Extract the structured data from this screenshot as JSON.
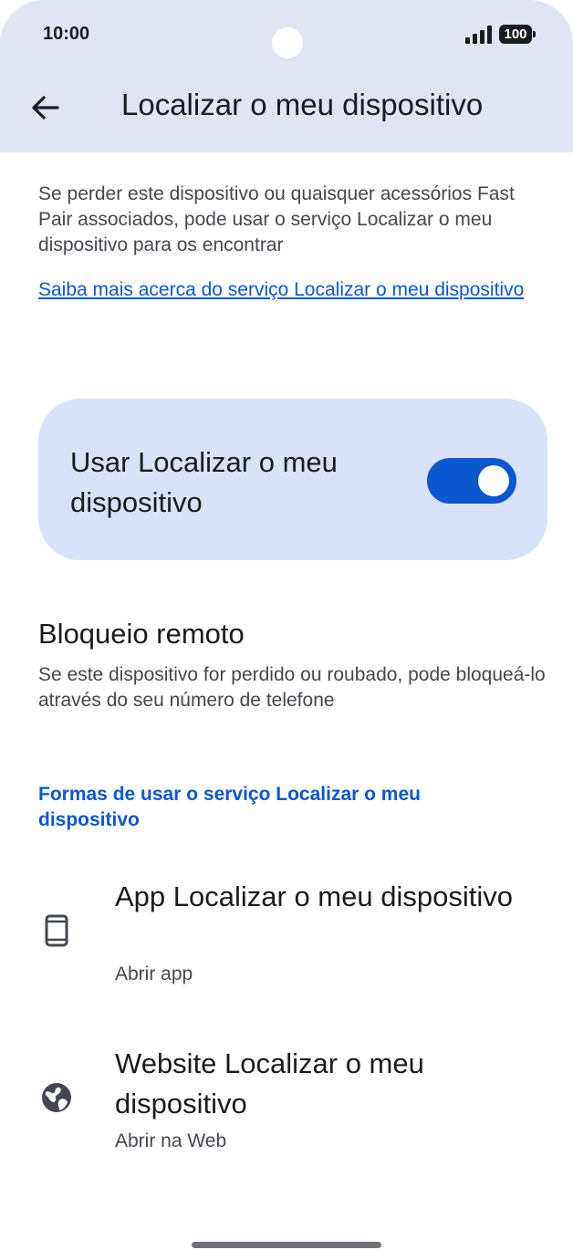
{
  "status_bar": {
    "time": "10:00",
    "battery": "100",
    "icons": [
      "signal-icon",
      "battery-icon"
    ]
  },
  "header": {
    "back_icon": "arrow-back-icon",
    "title": "Localizar o meu dispositivo"
  },
  "intro": {
    "description": "Se perder este dispositivo ou quaisquer acessórios Fast Pair associados, pode usar o serviço Localizar o meu dispositivo para os encontrar",
    "learn_more_link": "Saiba mais acerca do serviço Localizar o meu dispositivo"
  },
  "main_toggle": {
    "label": "Usar Localizar o meu dispositivo",
    "enabled": true
  },
  "remote_lock": {
    "title": "Bloqueio remoto",
    "subtitle": "Se este dispositivo for perdido ou roubado, pode bloqueá-lo através do seu número de telefone"
  },
  "ways_section": {
    "header": "Formas de usar o serviço Localizar o meu dispositivo",
    "items": [
      {
        "icon": "smartphone-icon",
        "title": "App Localizar o meu dispositivo",
        "subtitle": "Abrir app"
      },
      {
        "icon": "globe-icon",
        "title": "Website Localizar o meu dispositivo",
        "subtitle": "Abrir na Web"
      }
    ]
  },
  "colors": {
    "accent": "#0b57d0",
    "header_bg": "#e1e4f3",
    "card_bg": "#dae1fb"
  }
}
